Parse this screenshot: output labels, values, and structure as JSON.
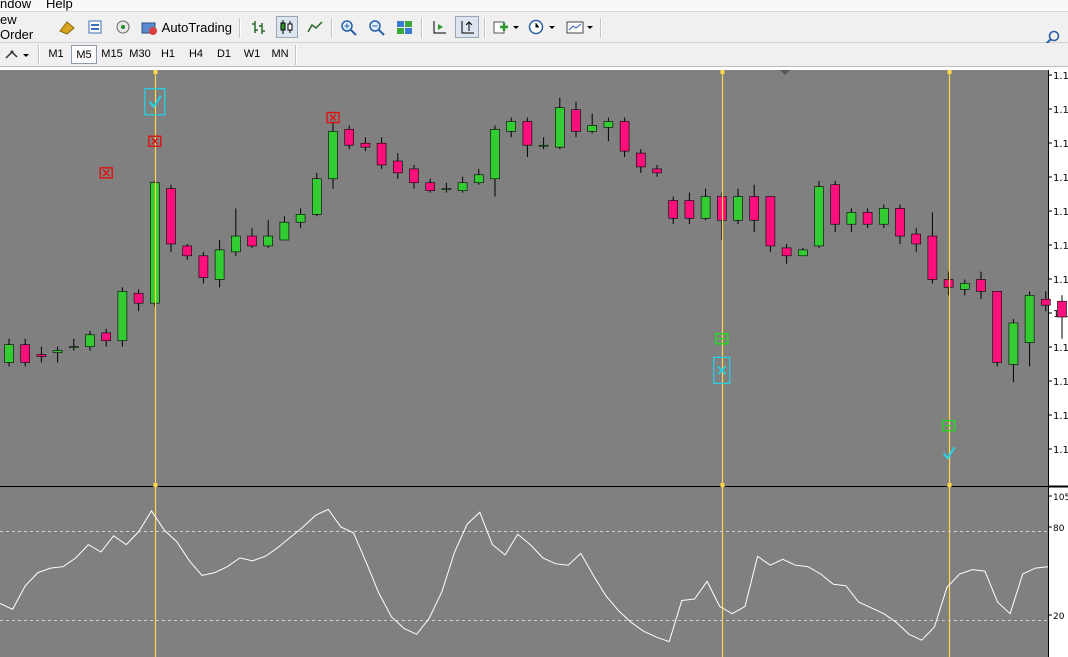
{
  "menu": {
    "window": "ndow",
    "help": "Help"
  },
  "toolbar": {
    "new_order": "ew Order",
    "autotrading": "AutoTrading"
  },
  "timeframes": {
    "items": [
      "M1",
      "M5",
      "M15",
      "M30",
      "H1",
      "H4",
      "D1",
      "W1",
      "MN"
    ],
    "active": "M5"
  },
  "chart_data": {
    "type": "candlestick",
    "colors": {
      "background": "#808080",
      "bull": "#33cc33",
      "bear": "#ff0f7b",
      "wick": "#000000",
      "vline": "#ffd54a",
      "indicator_line": "#ffffff",
      "level_line": "#cfcfcf"
    },
    "price_axis_labels": [
      "1.1",
      "1.1",
      "1.1",
      "1.1",
      "1.1",
      "1.1",
      "1.1",
      "1.1",
      "1.1",
      "1.1",
      "1.1",
      "1.1"
    ],
    "candles_norm": [
      [
        0.29,
        0.335,
        0.28,
        0.35
      ],
      [
        0.335,
        0.29,
        0.28,
        0.35
      ],
      [
        0.31,
        0.305,
        0.29,
        0.33
      ],
      [
        0.315,
        0.32,
        0.29,
        0.33
      ],
      [
        0.33,
        0.33,
        0.32,
        0.35
      ],
      [
        0.33,
        0.36,
        0.32,
        0.37
      ],
      [
        0.365,
        0.345,
        0.33,
        0.375
      ],
      [
        0.345,
        0.47,
        0.33,
        0.48
      ],
      [
        0.465,
        0.44,
        0.42,
        0.475
      ],
      [
        0.44,
        0.745,
        0.43,
        0.75
      ],
      [
        0.73,
        0.59,
        0.57,
        0.74
      ],
      [
        0.585,
        0.56,
        0.55,
        0.59
      ],
      [
        0.56,
        0.505,
        0.49,
        0.57
      ],
      [
        0.5,
        0.575,
        0.48,
        0.6
      ],
      [
        0.57,
        0.61,
        0.56,
        0.68
      ],
      [
        0.61,
        0.585,
        0.58,
        0.63
      ],
      [
        0.585,
        0.61,
        0.58,
        0.65
      ],
      [
        0.6,
        0.645,
        0.6,
        0.66
      ],
      [
        0.645,
        0.665,
        0.63,
        0.68
      ],
      [
        0.665,
        0.755,
        0.66,
        0.77
      ],
      [
        0.755,
        0.875,
        0.73,
        0.9
      ],
      [
        0.88,
        0.84,
        0.83,
        0.89
      ],
      [
        0.845,
        0.835,
        0.825,
        0.86
      ],
      [
        0.845,
        0.79,
        0.78,
        0.86
      ],
      [
        0.8,
        0.77,
        0.755,
        0.82
      ],
      [
        0.78,
        0.745,
        0.73,
        0.79
      ],
      [
        0.745,
        0.725,
        0.72,
        0.755
      ],
      [
        0.73,
        0.73,
        0.72,
        0.745
      ],
      [
        0.725,
        0.745,
        0.72,
        0.76
      ],
      [
        0.745,
        0.765,
        0.74,
        0.78
      ],
      [
        0.755,
        0.88,
        0.71,
        0.89
      ],
      [
        0.875,
        0.9,
        0.86,
        0.91
      ],
      [
        0.9,
        0.84,
        0.81,
        0.91
      ],
      [
        0.84,
        0.84,
        0.83,
        0.86
      ],
      [
        0.835,
        0.935,
        0.83,
        0.96
      ],
      [
        0.93,
        0.875,
        0.86,
        0.95
      ],
      [
        0.875,
        0.89,
        0.87,
        0.92
      ],
      [
        0.885,
        0.9,
        0.85,
        0.91
      ],
      [
        0.9,
        0.825,
        0.81,
        0.91
      ],
      [
        0.82,
        0.785,
        0.77,
        0.83
      ],
      [
        0.78,
        0.77,
        0.76,
        0.79
      ],
      [
        0.7,
        0.655,
        0.64,
        0.71
      ],
      [
        0.7,
        0.655,
        0.64,
        0.72
      ],
      [
        0.655,
        0.71,
        0.65,
        0.73
      ],
      [
        0.71,
        0.65,
        0.6,
        0.72
      ],
      [
        0.65,
        0.71,
        0.64,
        0.73
      ],
      [
        0.71,
        0.65,
        0.62,
        0.74
      ],
      [
        0.71,
        0.585,
        0.57,
        0.71
      ],
      [
        0.58,
        0.56,
        0.54,
        0.59
      ],
      [
        0.56,
        0.575,
        0.56,
        0.58
      ],
      [
        0.585,
        0.735,
        0.58,
        0.75
      ],
      [
        0.74,
        0.64,
        0.62,
        0.75
      ],
      [
        0.64,
        0.67,
        0.62,
        0.68
      ],
      [
        0.67,
        0.64,
        0.63,
        0.68
      ],
      [
        0.64,
        0.68,
        0.63,
        0.69
      ],
      [
        0.68,
        0.61,
        0.59,
        0.69
      ],
      [
        0.615,
        0.59,
        0.57,
        0.63
      ],
      [
        0.61,
        0.5,
        0.49,
        0.67
      ],
      [
        0.5,
        0.48,
        0.46,
        0.52
      ],
      [
        0.475,
        0.49,
        0.46,
        0.5
      ],
      [
        0.5,
        0.47,
        0.45,
        0.52
      ],
      [
        0.47,
        0.29,
        0.28,
        0.47
      ],
      [
        0.285,
        0.39,
        0.24,
        0.4
      ],
      [
        0.34,
        0.46,
        0.28,
        0.47
      ],
      [
        0.45,
        0.435,
        0.42,
        0.47
      ],
      [
        0.445,
        0.405,
        0.35,
        0.46
      ],
      [
        0.41,
        0.19,
        0.16,
        0.41
      ],
      [
        0.185,
        0.165,
        0.15,
        0.2
      ],
      [
        0.165,
        0.15,
        0.06,
        0.2
      ],
      [
        0.33,
        0.42,
        0.32,
        0.43
      ]
    ],
    "oscillator_levels": [
      20,
      80
    ],
    "oscillator_axis_labels": [
      "105",
      "80",
      "20"
    ],
    "oscillator_values_norm": [
      0.31,
      0.27,
      0.43,
      0.52,
      0.55,
      0.56,
      0.62,
      0.71,
      0.66,
      0.77,
      0.71,
      0.8,
      0.94,
      0.81,
      0.73,
      0.6,
      0.5,
      0.52,
      0.56,
      0.62,
      0.6,
      0.63,
      0.69,
      0.76,
      0.83,
      0.91,
      0.95,
      0.83,
      0.79,
      0.59,
      0.38,
      0.22,
      0.14,
      0.1,
      0.21,
      0.39,
      0.66,
      0.85,
      0.93,
      0.71,
      0.64,
      0.78,
      0.71,
      0.62,
      0.58,
      0.57,
      0.65,
      0.5,
      0.36,
      0.26,
      0.18,
      0.12,
      0.08,
      0.05,
      0.33,
      0.34,
      0.46,
      0.29,
      0.24,
      0.29,
      0.63,
      0.57,
      0.61,
      0.57,
      0.56,
      0.51,
      0.44,
      0.43,
      0.32,
      0.28,
      0.24,
      0.18,
      0.1,
      0.06,
      0.15,
      0.42,
      0.51,
      0.54,
      0.53,
      0.32,
      0.24,
      0.51,
      0.55,
      0.56
    ],
    "vertical_lines_index": [
      9,
      44,
      58
    ],
    "markers": [
      {
        "type": "red-x",
        "candle": 6,
        "level": 0.77
      },
      {
        "type": "red-x",
        "candle": 9,
        "level": 0.85
      },
      {
        "type": "red-x",
        "candle": 20,
        "level": 0.91
      },
      {
        "type": "cyan-check",
        "candle": 9,
        "level": 0.95
      },
      {
        "type": "green-sq",
        "candle": 44,
        "level": 0.35
      },
      {
        "type": "cyan-x",
        "candle": 44,
        "level": 0.27
      },
      {
        "type": "green-sq",
        "candle": 58,
        "level": 0.13
      },
      {
        "type": "cyan-check",
        "candle": 58,
        "level": 0.06
      }
    ]
  }
}
